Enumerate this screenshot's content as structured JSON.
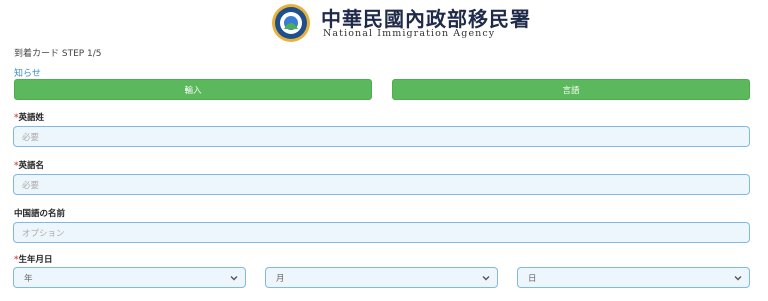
{
  "header": {
    "agency_name_cn": "中華民國內政部移民署",
    "agency_name_en": "National Immigration Agency"
  },
  "form": {
    "step_text": "到着カード STEP 1/5",
    "notice_link": "知らせ",
    "buttons": {
      "input": "輸入",
      "language": "言語"
    },
    "fields": [
      {
        "label": "英語姓",
        "required": true,
        "placeholder": "必要"
      },
      {
        "label": "英語名",
        "required": true,
        "placeholder": "必要"
      },
      {
        "label": "中国語の名前",
        "required": false,
        "placeholder": "オプション"
      }
    ],
    "birthdate": {
      "label": "生年月日",
      "required": true,
      "year": "年",
      "month": "月",
      "day": "日"
    }
  },
  "colors": {
    "button_green": "#5cb85c",
    "field_border": "#7fb9e6",
    "field_bg": "#eef6fd",
    "required_mark": "#d9534f"
  }
}
